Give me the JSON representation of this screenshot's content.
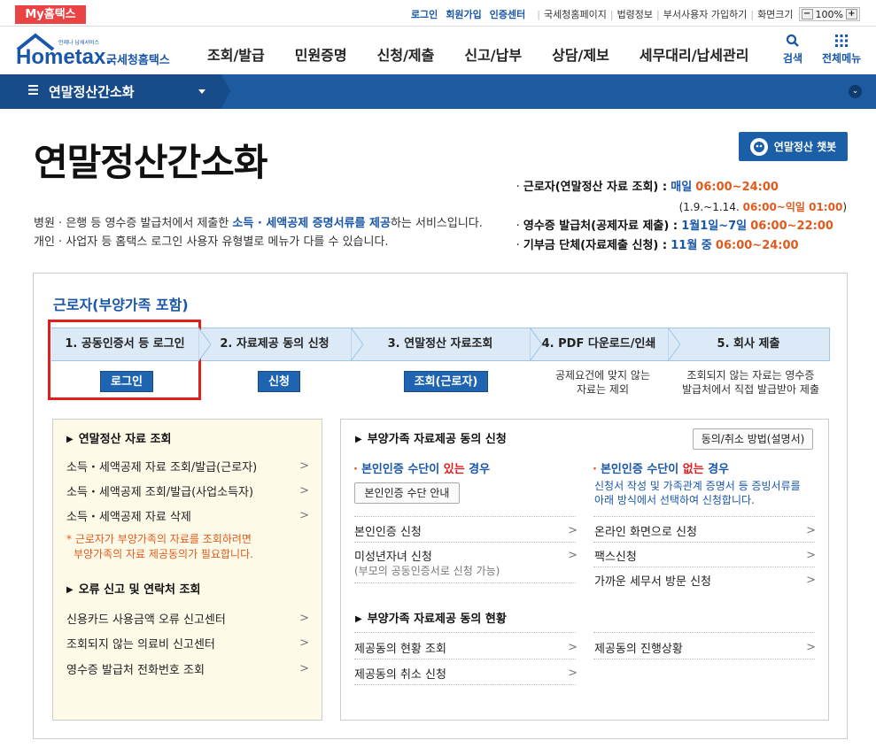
{
  "topbar": {
    "mytax": "My홈택스",
    "links": [
      "로그인",
      "회원가입",
      "인증센터"
    ],
    "plain_links": [
      "국세청홈페이지",
      "법령정보",
      "부서사용자 가입하기",
      "화면크기"
    ],
    "zoom_minus": "−",
    "zoom_value": "100%",
    "zoom_plus": "+"
  },
  "header": {
    "logo_small": "언제나 납세서비스",
    "logo_main": "Hometax.",
    "logo_sub": "국세청홈택스",
    "menu": [
      "조회/발급",
      "민원증명",
      "신청/제출",
      "신고/납부",
      "상담/제보",
      "세무대리/납세관리"
    ],
    "search_label": "검색",
    "allmenu_label": "전체메뉴"
  },
  "navbar": {
    "current": "연말정산간소화"
  },
  "page": {
    "title": "연말정산간소화",
    "chatbot": "연말정산 챗봇",
    "desc_line1_a": "병원 · 은행 등 영수증 발급처에서 제출한 ",
    "desc_line1_b": "소득 · 세액공제 증명서류를 제공",
    "desc_line1_c": "하는 서비스입니다.",
    "desc_line2": "개인 · 사업자 등 홈택스 로그인 사용자 유형별로 메뉴가 다를 수 있습니다."
  },
  "schedule": {
    "r1_label": "근로자(연말정산 자료 조회) :",
    "r1_blue": "매일",
    "r1_red": "06:00~24:00",
    "r1_sub_a": "(1.9.~1.14.",
    "r1_sub_b": "06:00~익일 01:00",
    "r1_sub_c": ")",
    "r2_label": "영수증 발급처(공제자료 제출) :",
    "r2_blue": "1월1일~7일",
    "r2_red": "06:00~22:00",
    "r3_label": "기부금 단체(자료제출 신청) :",
    "r3_blue": "11월 중",
    "r3_red": "06:00~24:00"
  },
  "card": {
    "title": "근로자(부양가족 포함)",
    "steps": [
      "1. 공동인증서 등 로그인",
      "2. 자료제공 동의 신청",
      "3. 연말정산 자료조회",
      "4. PDF 다운로드/인쇄",
      "5. 회사 제출"
    ],
    "btn_login": "로그인",
    "btn_apply": "신청",
    "btn_query": "조회(근로자)",
    "note4_l1": "공제요건에 맞지 않는",
    "note4_l2": "자료는 제외",
    "note5_l1": "조회되지 않는 자료는 영수증",
    "note5_l2": "발급처에서 직접 발급받아 제출"
  },
  "left": {
    "h1": "연말정산 자료 조회",
    "items1": [
      "소득・세액공제 자료 조회/발급(근로자)",
      "소득・세액공제 조회/발급(사업소득자)",
      "소득・세액공제 자료 삭제"
    ],
    "note_l1": "* 근로자가 부양가족의 자료를 조회하려면",
    "note_l2": "부양가족의 자료 제공동의가 필요합니다.",
    "h2": "오류 신고 및 연락처 조회",
    "items2": [
      "신용카드 사용금액 오류 신고센터",
      "조회되지 않는 의료비 신고센터",
      "영수증 발급처 전화번호 조회"
    ]
  },
  "right": {
    "h1": "부양가족 자료제공 동의 신청",
    "method_btn": "동의/취소 방법(설명서)",
    "has_a": "본인인증 수단이 ",
    "has_b": "있는",
    "has_c": " 경우",
    "none_a": "본인인증 수단이 ",
    "none_b": "없는",
    "none_c": " 경우",
    "guide_btn": "본인인증 수단 안내",
    "none_note_l1": "신청서 작성 및 가족관계 증명서 등 증빙서류를",
    "none_note_l2": "아래 방식에서 선택하여 신청합니다.",
    "left_items": [
      "본인인증 신청",
      "미성년자녀 신청"
    ],
    "minor_sub": "(부모의 공동인증서로 신청 가능)",
    "right_items": [
      "온라인 화면으로 신청",
      "팩스신청",
      "가까운 세무서 방문 신청"
    ],
    "h2": "부양가족 자료제공 동의 현황",
    "status_left": [
      "제공동의 현황 조회",
      "제공동의 취소 신청"
    ],
    "status_right": [
      "제공동의 진행상황"
    ]
  },
  "colors": {
    "brand_blue": "#1a57a8",
    "nav_blue": "#1e5aa0",
    "accent_red": "#e94343",
    "time_orange": "#e25a1c",
    "highlight_box": "#e31c1c"
  }
}
